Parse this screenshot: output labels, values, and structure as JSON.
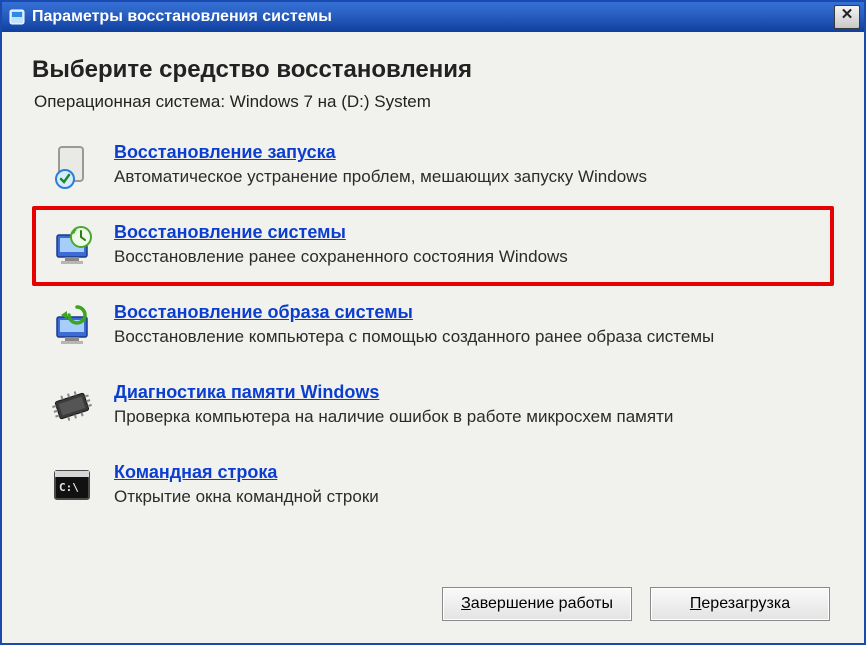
{
  "window": {
    "title": "Параметры восстановления системы",
    "close_glyph": "✕"
  },
  "heading": "Выберите средство восстановления",
  "subheading": "Операционная система: Windows 7 на (D:) System",
  "options": [
    {
      "title": "Восстановление запуска",
      "desc": "Автоматическое устранение проблем, мешающих запуску Windows"
    },
    {
      "title": "Восстановление системы",
      "desc": "Восстановление ранее сохраненного состояния Windows"
    },
    {
      "title": "Восстановление образа системы",
      "desc": "Восстановление компьютера с помощью  созданного ранее образа системы"
    },
    {
      "title": "Диагностика памяти Windows",
      "desc": "Проверка компьютера на наличие ошибок в работе микросхем памяти"
    },
    {
      "title": "Командная строка",
      "desc": "Открытие окна командной строки"
    }
  ],
  "buttons": {
    "shutdown_mnemonic": "З",
    "shutdown_rest": "авершение работы",
    "restart_mnemonic": "П",
    "restart_rest": "ерезагрузка"
  }
}
